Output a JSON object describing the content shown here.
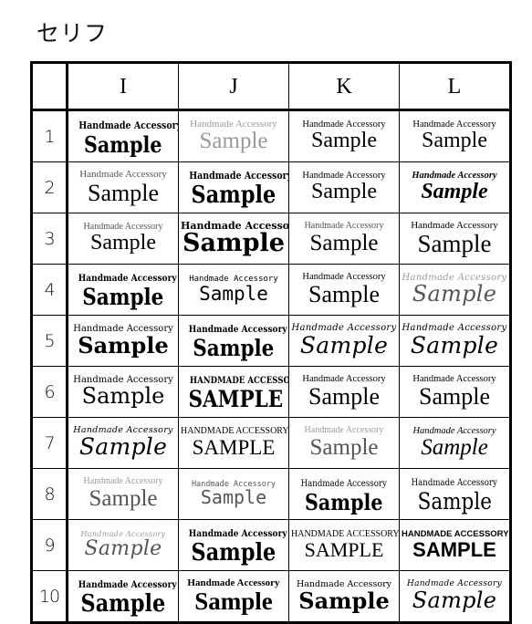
{
  "page": {
    "title": "セリフ",
    "background_color": "#ffffff",
    "text_color": "#000000"
  },
  "table": {
    "index_header": "",
    "column_headers": [
      "I",
      "J",
      "K",
      "L"
    ],
    "row_labels": [
      "1",
      "2",
      "3",
      "4",
      "5",
      "6",
      "7",
      "8",
      "9",
      "10"
    ],
    "sample_top_text": "Handmade Accessory",
    "sample_main_text": "Sample",
    "rows": [
      {
        "label": "1",
        "cells": [
          {
            "top": "Handmade Accessory",
            "main": "Sample"
          },
          {
            "top": "Handmade Accessory",
            "main": "Sample"
          },
          {
            "top": "Handmade Accessory",
            "main": "Sample"
          },
          {
            "top": "Handmade Accessory",
            "main": "Sample"
          }
        ]
      },
      {
        "label": "2",
        "cells": [
          {
            "top": "Handmade Accessory",
            "main": "Sample"
          },
          {
            "top": "Handmade Accessory",
            "main": "Sample"
          },
          {
            "top": "Handmade Accessory",
            "main": "Sample"
          },
          {
            "top": "Handmade Accessory",
            "main": "Sample"
          }
        ]
      },
      {
        "label": "3",
        "cells": [
          {
            "top": "Handmade Accessory",
            "main": "Sample"
          },
          {
            "top": "Handmade Accessory",
            "main": "Sample"
          },
          {
            "top": "Handmade Accessory",
            "main": "Sample"
          },
          {
            "top": "Handmade Accessory",
            "main": "Sample"
          }
        ]
      },
      {
        "label": "4",
        "cells": [
          {
            "top": "Handmade Accessory",
            "main": "Sample"
          },
          {
            "top": "Handmade Accessory",
            "main": "Sample"
          },
          {
            "top": "Handmade Accessory",
            "main": "Sample"
          },
          {
            "top": "Handmade Accessory",
            "main": "Sample"
          }
        ]
      },
      {
        "label": "5",
        "cells": [
          {
            "top": "Handmade Accessory",
            "main": "Sample"
          },
          {
            "top": "Handmade Accessory",
            "main": "Sample"
          },
          {
            "top": "Handmade Accessory",
            "main": "Sample"
          },
          {
            "top": "Handmade Accessory",
            "main": "Sample"
          }
        ]
      },
      {
        "label": "6",
        "cells": [
          {
            "top": "Handmade Accessory",
            "main": "Sample"
          },
          {
            "top": "HANDMADE ACCESSORY",
            "main": "SAMPLE"
          },
          {
            "top": "Handmade Accessory",
            "main": "Sample"
          },
          {
            "top": "Handmade Accessory",
            "main": "Sample"
          }
        ]
      },
      {
        "label": "7",
        "cells": [
          {
            "top": "Handmade Accessory",
            "main": "Sample"
          },
          {
            "top": "HANDMADE ACCESSORY",
            "main": "SAMPLE"
          },
          {
            "top": "Handmade Accessory",
            "main": "Sample"
          },
          {
            "top": "Handmade Accessory",
            "main": "Sample"
          }
        ]
      },
      {
        "label": "8",
        "cells": [
          {
            "top": "Handmade Accessory",
            "main": "Sample"
          },
          {
            "top": "Handmade Accessory",
            "main": "Sample"
          },
          {
            "top": "Handmade Accessory",
            "main": "Sample"
          },
          {
            "top": "Handmade Accessory",
            "main": "Sample"
          }
        ]
      },
      {
        "label": "9",
        "cells": [
          {
            "top": "Handmade Accessory",
            "main": "Sample"
          },
          {
            "top": "Handmade Accessory",
            "main": "Sample"
          },
          {
            "top": "HANDMADE ACCESSORY",
            "main": "SAMPLE"
          },
          {
            "top": "HANDMADE ACCESSORY",
            "main": "SAMPLE"
          }
        ]
      },
      {
        "label": "10",
        "cells": [
          {
            "top": "Handmade Accessory",
            "main": "Sample"
          },
          {
            "top": "Handmade Accessory",
            "main": "Sample"
          },
          {
            "top": "Handmade Accessory",
            "main": "Sample"
          },
          {
            "top": "Handmade Accessory",
            "main": "Sample"
          }
        ]
      }
    ]
  }
}
